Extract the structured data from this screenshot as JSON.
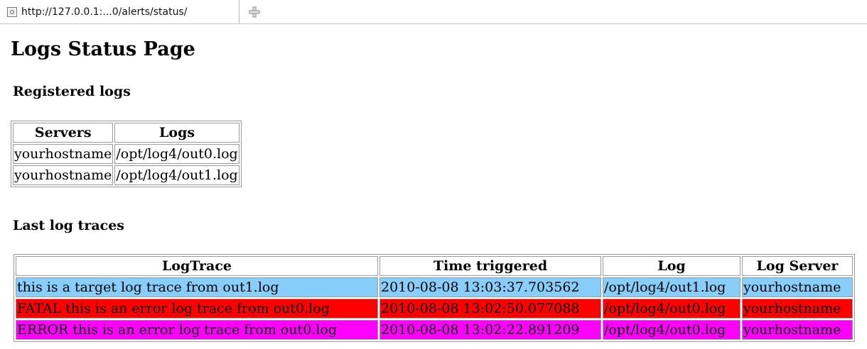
{
  "browser": {
    "tab_title": "http://127.0.0.1:...0/alerts/status/"
  },
  "page": {
    "title": "Logs Status Page"
  },
  "registered": {
    "heading": "Registered logs",
    "headers": [
      "Servers",
      "Logs"
    ],
    "rows": [
      [
        "yourhostname",
        "/opt/log4/out0.log"
      ],
      [
        "yourhostname",
        "/opt/log4/out1.log"
      ]
    ]
  },
  "traces": {
    "heading": "Last log traces",
    "headers": [
      "LogTrace",
      "Time triggered",
      "Log",
      "Log Server"
    ],
    "rows": [
      {
        "color": "#87cefa",
        "text_color": "#000000",
        "cells": [
          "this is a target log trace from out1.log",
          "2010-08-08 13:03:37.703562",
          "/opt/log4/out1.log",
          "yourhostname"
        ]
      },
      {
        "color": "#ff0000",
        "text_color": "#000000",
        "cells": [
          "FATAL this is an error log trace from out0.log",
          "2010-08-08 13:02:50.077088",
          "/opt/log4/out0.log",
          "yourhostname"
        ]
      },
      {
        "color": "#ff00ff",
        "text_color": "#000000",
        "cells": [
          "ERROR this is an error log trace from out0.log",
          "2010-08-08 13:02:22.891209",
          "/opt/log4/out0.log",
          "yourhostname"
        ]
      }
    ]
  }
}
